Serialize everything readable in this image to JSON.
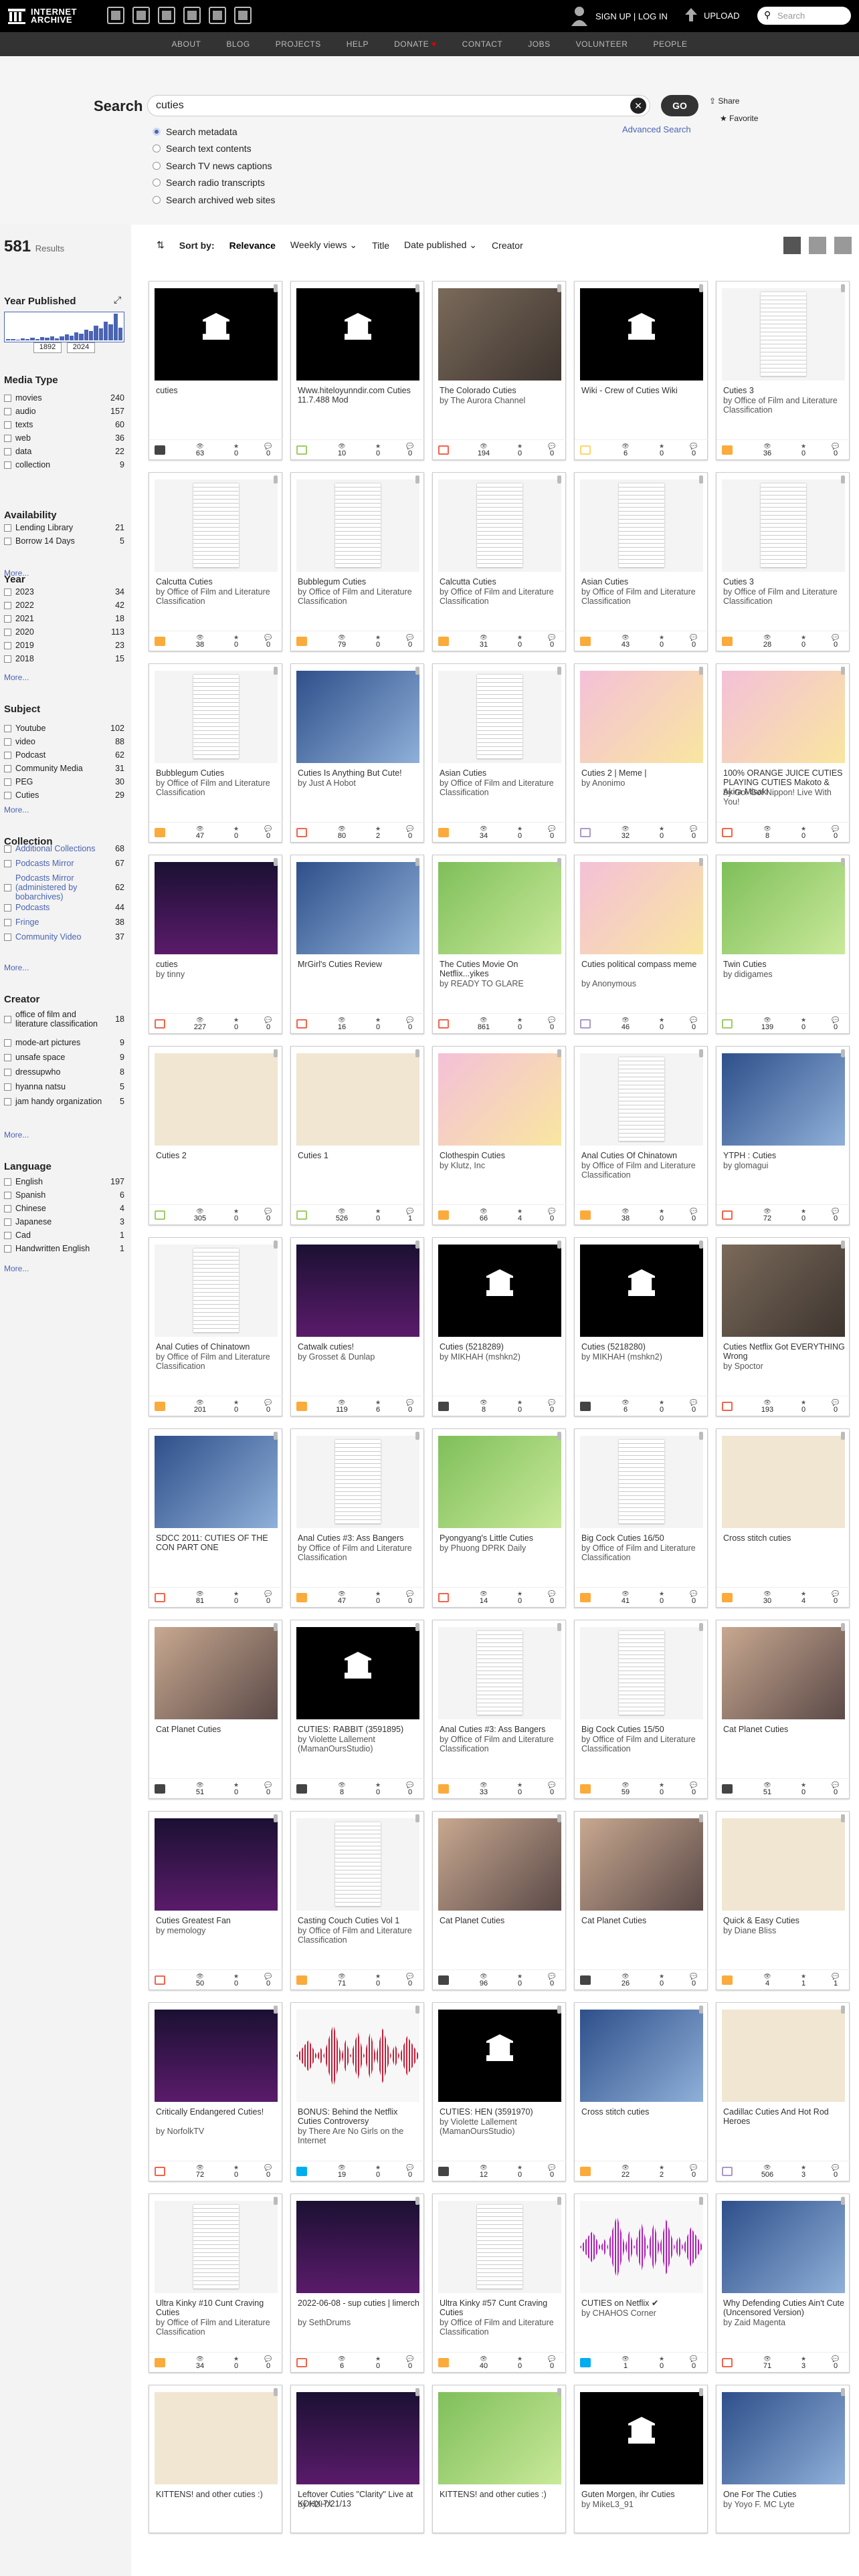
{
  "topbar": {
    "logo_line1": "INTERNET",
    "logo_line2": "ARCHIVE",
    "signup": "SIGN UP | LOG IN",
    "upload": "UPLOAD",
    "search_placeholder": "Search"
  },
  "subnav": [
    "ABOUT",
    "BLOG",
    "PROJECTS",
    "HELP",
    "DONATE",
    "CONTACT",
    "JOBS",
    "VOLUNTEER",
    "PEOPLE"
  ],
  "search": {
    "label": "Search",
    "query": "cuties",
    "go": "GO",
    "share": "Share",
    "favorite": "Favorite",
    "advanced": "Advanced Search",
    "options": [
      "Search metadata",
      "Search text contents",
      "Search TV news captions",
      "Search radio transcripts",
      "Search archived web sites"
    ]
  },
  "results": {
    "count": "581",
    "label": "Results"
  },
  "sort": {
    "label": "Sort by:",
    "relevance": "Relevance",
    "weekly": "Weekly views",
    "title": "Title",
    "date": "Date published",
    "creator": "Creator"
  },
  "facets": {
    "year_published": {
      "title": "Year Published",
      "from": "1892",
      "to": "2024"
    },
    "media_type": {
      "title": "Media Type",
      "rows": [
        [
          "movies",
          "240"
        ],
        [
          "audio",
          "157"
        ],
        [
          "texts",
          "60"
        ],
        [
          "web",
          "36"
        ],
        [
          "data",
          "22"
        ],
        [
          "collection",
          "9"
        ]
      ]
    },
    "availability": {
      "title": "Availability",
      "rows": [
        [
          "Lending Library",
          "21"
        ],
        [
          "Borrow 14 Days",
          "5"
        ]
      ]
    },
    "year": {
      "title": "Year",
      "rows": [
        [
          "2023",
          "34"
        ],
        [
          "2022",
          "42"
        ],
        [
          "2021",
          "18"
        ],
        [
          "2020",
          "113"
        ],
        [
          "2019",
          "23"
        ],
        [
          "2018",
          "15"
        ]
      ]
    },
    "subject": {
      "title": "Subject",
      "rows": [
        [
          "Youtube",
          "102"
        ],
        [
          "video",
          "88"
        ],
        [
          "Podcast",
          "62"
        ],
        [
          "Community Media",
          "31"
        ],
        [
          "PEG",
          "30"
        ],
        [
          "Cuties",
          "29"
        ]
      ]
    },
    "collection": {
      "title": "Collection",
      "rows": [
        [
          "Additional Collections",
          "68"
        ],
        [
          "Podcasts Mirror",
          "67"
        ],
        [
          "Podcasts Mirror (administered by bobarchives)",
          "62"
        ],
        [
          "Podcasts",
          "44"
        ],
        [
          "Fringe",
          "38"
        ],
        [
          "Community Video",
          "37"
        ]
      ]
    },
    "creator": {
      "title": "Creator",
      "rows": [
        [
          "office of film and literature classification",
          "18"
        ],
        [
          "mode-art pictures",
          "9"
        ],
        [
          "unsafe space",
          "9"
        ],
        [
          "dressupwho",
          "8"
        ],
        [
          "hyanna natsu",
          "5"
        ],
        [
          "jam handy organization",
          "5"
        ]
      ]
    },
    "language": {
      "title": "Language",
      "rows": [
        [
          "English",
          "197"
        ],
        [
          "Spanish",
          "6"
        ],
        [
          "Chinese",
          "4"
        ],
        [
          "Japanese",
          "3"
        ],
        [
          "Cad",
          "1"
        ],
        [
          "Handwritten English",
          "1"
        ]
      ]
    },
    "more": "More..."
  },
  "stat_labels": {
    "views": "👁",
    "favs": "★",
    "reviews": "💬"
  },
  "items": [
    {
      "title": "cuties",
      "by": "",
      "type": "coll",
      "th": "black",
      "v": "63",
      "f": "0",
      "r": "0"
    },
    {
      "title": "Www.hiteloyunndir.com Cuties 11.7.488 Mod",
      "by": "",
      "type": "soft",
      "th": "black",
      "v": "10",
      "f": "0",
      "r": "0"
    },
    {
      "title": "The Colorado Cuties",
      "by": "by The Aurora Channel",
      "type": "movies",
      "th": "photo",
      "v": "194",
      "f": "0",
      "r": "0"
    },
    {
      "title": "Wiki - Crew of Cuties Wiki",
      "by": "",
      "type": "web",
      "th": "black",
      "v": "6",
      "f": "0",
      "r": "0"
    },
    {
      "title": "Cuties 3",
      "by": "by Office of Film and Literature Classification",
      "type": "texts",
      "th": "doc",
      "v": "36",
      "f": "0",
      "r": "0"
    },
    {
      "title": "Calcutta Cuties",
      "by": "by Office of Film and Literature Classification",
      "type": "texts",
      "th": "doc",
      "v": "38",
      "f": "0",
      "r": "0"
    },
    {
      "title": "Bubblegum Cuties",
      "by": "by Office of Film and Literature Classification",
      "type": "texts",
      "th": "doc",
      "v": "79",
      "f": "0",
      "r": "0"
    },
    {
      "title": "Calcutta Cuties",
      "by": "by Office of Film and Literature Classification",
      "type": "texts",
      "th": "doc",
      "v": "31",
      "f": "0",
      "r": "0"
    },
    {
      "title": "Asian Cuties",
      "by": "by Office of Film and Literature Classification",
      "type": "texts",
      "th": "doc",
      "v": "43",
      "f": "0",
      "r": "0"
    },
    {
      "title": "Cuties 3",
      "by": "by Office of Film and Literature Classification",
      "type": "texts",
      "th": "doc",
      "v": "28",
      "f": "0",
      "r": "0"
    },
    {
      "title": "Bubblegum Cuties",
      "by": "by Office of Film and Literature Classification",
      "type": "texts",
      "th": "doc",
      "v": "47",
      "f": "0",
      "r": "0"
    },
    {
      "title": "Cuties Is Anything But Cute!",
      "by": "by Just A Hobot",
      "type": "movies",
      "th": "blue",
      "v": "80",
      "f": "2",
      "r": "0"
    },
    {
      "title": "Asian Cuties",
      "by": "by Office of Film and Literature Classification",
      "type": "texts",
      "th": "doc",
      "v": "34",
      "f": "0",
      "r": "0"
    },
    {
      "title": "Cuties 2 | Meme |",
      "by": "by Anonimo",
      "type": "img",
      "th": "pink",
      "v": "32",
      "f": "0",
      "r": "0"
    },
    {
      "title": "100% ORANGE JUICE CUTIES PLAYING CUTIES Makoto & Akira Misaki",
      "by": "by Go! Go! Nippon! Live With You!",
      "type": "movies",
      "th": "pink",
      "v": "8",
      "f": "0",
      "r": "0"
    },
    {
      "title": "cuties",
      "by": "by tinny",
      "type": "movies",
      "th": "night",
      "v": "227",
      "f": "0",
      "r": "0"
    },
    {
      "title": "MrGirl's Cuties Review",
      "by": "",
      "type": "movies",
      "th": "blue",
      "v": "16",
      "f": "0",
      "r": "0"
    },
    {
      "title": "The Cuties Movie On Netflix...yikes",
      "by": "by READY TO GLARE",
      "type": "movies",
      "th": "green",
      "v": "861",
      "f": "0",
      "r": "0"
    },
    {
      "title": "Cuties political compass meme",
      "by": "by Anonymous",
      "type": "img",
      "th": "pink",
      "v": "46",
      "f": "0",
      "r": "0"
    },
    {
      "title": "Twin Cuties",
      "by": "by didigames",
      "type": "soft",
      "th": "green",
      "v": "139",
      "f": "0",
      "r": "0"
    },
    {
      "title": "Cuties 2",
      "by": "",
      "type": "soft",
      "th": "cream",
      "v": "305",
      "f": "0",
      "r": "0"
    },
    {
      "title": "Cuties 1",
      "by": "",
      "type": "soft",
      "th": "cream",
      "v": "526",
      "f": "0",
      "r": "1"
    },
    {
      "title": "Clothespin Cuties",
      "by": "by Klutz, Inc",
      "type": "texts",
      "th": "pink",
      "v": "66",
      "f": "4",
      "r": "0"
    },
    {
      "title": "Anal Cuties Of Chinatown",
      "by": "by Office of Film and Literature Classification",
      "type": "texts",
      "th": "doc",
      "v": "38",
      "f": "0",
      "r": "0"
    },
    {
      "title": "YTPH : Cuties",
      "by": "by glomagui",
      "type": "movies",
      "th": "blue",
      "v": "72",
      "f": "0",
      "r": "0"
    },
    {
      "title": "Anal Cuties of Chinatown",
      "by": "by Office of Film and Literature Classification",
      "type": "texts",
      "th": "doc",
      "v": "201",
      "f": "0",
      "r": "0"
    },
    {
      "title": "Catwalk cuties!",
      "by": "by Grosset & Dunlap",
      "type": "texts",
      "th": "night",
      "v": "119",
      "f": "6",
      "r": "0"
    },
    {
      "title": "Cuties (5218289)",
      "by": "by MIKHAH (mshkn2)",
      "type": "coll",
      "th": "black",
      "v": "8",
      "f": "0",
      "r": "0"
    },
    {
      "title": "Cuties (5218280)",
      "by": "by MIKHAH (mshkn2)",
      "type": "coll",
      "th": "black",
      "v": "6",
      "f": "0",
      "r": "0"
    },
    {
      "title": "Cuties Netflix Got EVERYTHING Wrong",
      "by": "by Spoctor",
      "type": "movies",
      "th": "photo",
      "v": "193",
      "f": "0",
      "r": "0"
    },
    {
      "title": "SDCC 2011: CUTIES OF THE CON PART ONE",
      "by": "",
      "type": "movies",
      "th": "blue",
      "v": "81",
      "f": "0",
      "r": "0"
    },
    {
      "title": "Anal Cuties #3: Ass Bangers",
      "by": "by Office of Film and Literature Classification",
      "type": "texts",
      "th": "doc",
      "v": "47",
      "f": "0",
      "r": "0"
    },
    {
      "title": "Pyongyang's Little Cuties",
      "by": "by Phuong DPRK Daily",
      "type": "movies",
      "th": "green",
      "v": "14",
      "f": "0",
      "r": "0"
    },
    {
      "title": "Big Cock Cuties 16/50",
      "by": "by Office of Film and Literature Classification",
      "type": "texts",
      "th": "doc",
      "v": "41",
      "f": "0",
      "r": "0"
    },
    {
      "title": "Cross stitch cuties",
      "by": "",
      "type": "texts",
      "th": "cream",
      "v": "30",
      "f": "4",
      "r": "0"
    },
    {
      "title": "Cat Planet Cuties",
      "by": "",
      "type": "coll",
      "th": "anime",
      "v": "51",
      "f": "0",
      "r": "0"
    },
    {
      "title": "CUTIES: RABBIT (3591895)",
      "by": "by Violette Lallement (MamanOursStudio)",
      "type": "coll",
      "th": "black",
      "v": "8",
      "f": "0",
      "r": "0"
    },
    {
      "title": "Anal Cuties #3: Ass Bangers",
      "by": "by Office of Film and Literature Classification",
      "type": "texts",
      "th": "doc",
      "v": "33",
      "f": "0",
      "r": "0"
    },
    {
      "title": "Big Cock Cuties 15/50",
      "by": "by Office of Film and Literature Classification",
      "type": "texts",
      "th": "doc",
      "v": "59",
      "f": "0",
      "r": "0"
    },
    {
      "title": "Cat Planet Cuties",
      "by": "",
      "type": "coll",
      "th": "anime",
      "v": "51",
      "f": "0",
      "r": "0"
    },
    {
      "title": "Cuties Greatest Fan",
      "by": "by memology",
      "type": "movies",
      "th": "night",
      "v": "50",
      "f": "0",
      "r": "0"
    },
    {
      "title": "Casting Couch Cuties Vol 1",
      "by": "by Office of Film and Literature Classification",
      "type": "texts",
      "th": "doc",
      "v": "71",
      "f": "0",
      "r": "0"
    },
    {
      "title": "Cat Planet Cuties",
      "by": "",
      "type": "coll",
      "th": "anime",
      "v": "96",
      "f": "0",
      "r": "0"
    },
    {
      "title": "Cat Planet Cuties",
      "by": "",
      "type": "coll",
      "th": "anime",
      "v": "26",
      "f": "0",
      "r": "0"
    },
    {
      "title": "Quick & Easy Cuties",
      "by": "by Diane Bliss",
      "type": "texts",
      "th": "cream",
      "v": "4",
      "f": "1",
      "r": "1"
    },
    {
      "title": "Critically Endangered Cuties!",
      "by": "by NorfolkTV",
      "type": "movies",
      "th": "night",
      "v": "72",
      "f": "0",
      "r": "0"
    },
    {
      "title": "BONUS: Behind the Netflix Cuties Controversy",
      "by": "by There Are No Girls on the Internet",
      "type": "audio",
      "th": "wave",
      "v": "19",
      "f": "0",
      "r": "0"
    },
    {
      "title": "CUTIES: HEN (3591970)",
      "by": "by Violette Lallement (MamanOursStudio)",
      "type": "coll",
      "th": "black",
      "v": "12",
      "f": "0",
      "r": "0"
    },
    {
      "title": "Cross stitch cuties",
      "by": "",
      "type": "texts",
      "th": "blue",
      "v": "22",
      "f": "2",
      "r": "0"
    },
    {
      "title": "Cadillac Cuties And Hot Rod Heroes",
      "by": "",
      "type": "img",
      "th": "cream",
      "v": "506",
      "f": "3",
      "r": "0"
    },
    {
      "title": "Ultra Kinky #10 Cunt Craving Cuties",
      "by": "by Office of Film and Literature Classification",
      "type": "texts",
      "th": "doc",
      "v": "34",
      "f": "0",
      "r": "0"
    },
    {
      "title": "2022-06-08 - sup cuties | limerch",
      "by": "by SethDrums",
      "type": "movies",
      "th": "night",
      "v": "6",
      "f": "0",
      "r": "0"
    },
    {
      "title": "Ultra Kinky #57 Cunt Craving Cuties",
      "by": "by Office of Film and Literature Classification",
      "type": "texts",
      "th": "doc",
      "v": "40",
      "f": "0",
      "r": "0"
    },
    {
      "title": "CUTIES on Netflix ✔",
      "by": "by CHAHOS Corner",
      "type": "audio",
      "th": "wave purple",
      "v": "1",
      "f": "0",
      "r": "0"
    },
    {
      "title": "Why Defending Cuties Ain't Cute (Uncensored Version)",
      "by": "by Zaid Magenta",
      "type": "movies",
      "th": "blue",
      "v": "71",
      "f": "3",
      "r": "0"
    },
    {
      "title": "KITTENS! and other cuties :)",
      "by": "",
      "type": "movies",
      "th": "cream",
      "v": "",
      "f": "",
      "r": ""
    },
    {
      "title": "Leftover Cuties \"Clarity\" Live at KDHX 7/21/13",
      "by": "by KDHX",
      "type": "movies",
      "th": "night",
      "v": "",
      "f": "",
      "r": ""
    },
    {
      "title": "KITTENS! and other cuties :)",
      "by": "",
      "type": "movies",
      "th": "green",
      "v": "",
      "f": "",
      "r": ""
    },
    {
      "title": "Guten Morgen, ihr Cuties",
      "by": "by MikeL3_91",
      "type": "audio",
      "th": "black",
      "v": "",
      "f": "",
      "r": ""
    },
    {
      "title": "One For The Cuties",
      "by": "by Yoyo F. MC Lyte",
      "type": "audio",
      "th": "blue",
      "v": "",
      "f": "",
      "r": ""
    }
  ]
}
